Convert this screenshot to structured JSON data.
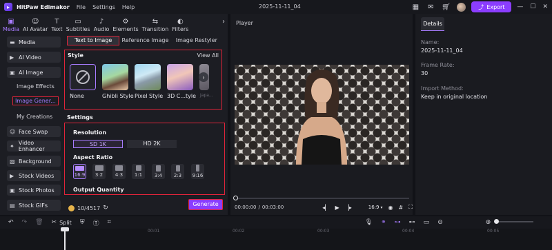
{
  "app": {
    "name": "HitPaw Edimakor",
    "doc_title": "2025-11-11_04"
  },
  "menu": [
    "File",
    "Settings",
    "Help"
  ],
  "header": {
    "export_label": "Export"
  },
  "toolbar": [
    {
      "label": "Media",
      "icon": "media-icon",
      "active": true
    },
    {
      "label": "AI Avatar",
      "icon": "ai-avatar-icon"
    },
    {
      "label": "Text",
      "icon": "text-icon"
    },
    {
      "label": "Subtitles",
      "icon": "subtitles-icon"
    },
    {
      "label": "Audio",
      "icon": "audio-icon"
    },
    {
      "label": "Elements",
      "icon": "elements-icon"
    },
    {
      "label": "Transition",
      "icon": "transition-icon"
    },
    {
      "label": "Filters",
      "icon": "filters-icon"
    }
  ],
  "sidebar": {
    "media": "Media",
    "ai_video": "AI Video",
    "ai_image": "AI Image",
    "sub_image_effects": "Image Effects",
    "sub_image_gen": "Image Gener...",
    "sub_my_creations": "My Creations",
    "face_swap": "Face Swap",
    "video_enhancer": "Video Enhancer",
    "background": "Background",
    "stock_videos": "Stock Videos",
    "stock_photos": "Stock Photos",
    "stock_gifs": "Stock GIFs"
  },
  "tabs": [
    "Text to Image",
    "Reference Image",
    "Image Restyler"
  ],
  "style": {
    "title": "Style",
    "view_all": "View All",
    "items": [
      "None",
      "Ghibli Style",
      "Pixel Style",
      "3D C...tyle",
      "Japa..."
    ]
  },
  "settings": {
    "title": "Settings",
    "resolution_label": "Resolution",
    "resolutions": [
      "SD 1K",
      "HD 2K"
    ],
    "aspect_label": "Aspect Ratio",
    "aspects": [
      "16:9",
      "3:2",
      "4:3",
      "1:1",
      "3:4",
      "2:3",
      "9:16"
    ],
    "output_label": "Output Quantity"
  },
  "credits": {
    "value": "10/4517"
  },
  "generate_label": "Generate",
  "player": {
    "title": "Player",
    "time_current": "00:00:00",
    "time_total": "00:03:00",
    "ratio": "16:9"
  },
  "details": {
    "tab": "Details",
    "name_label": "Name:",
    "name_value": "2025-11-11_04",
    "fps_label": "Frame Rate:",
    "fps_value": "30",
    "import_label": "Import Method:",
    "import_value": "Keep in original location"
  },
  "timeline": {
    "split_label": "Split",
    "ticks": [
      "00:01",
      "00:02",
      "00:03",
      "00:04",
      "00:05"
    ]
  },
  "colors": {
    "accent": "#8b3dff",
    "highlight_box": "#e0243a"
  }
}
